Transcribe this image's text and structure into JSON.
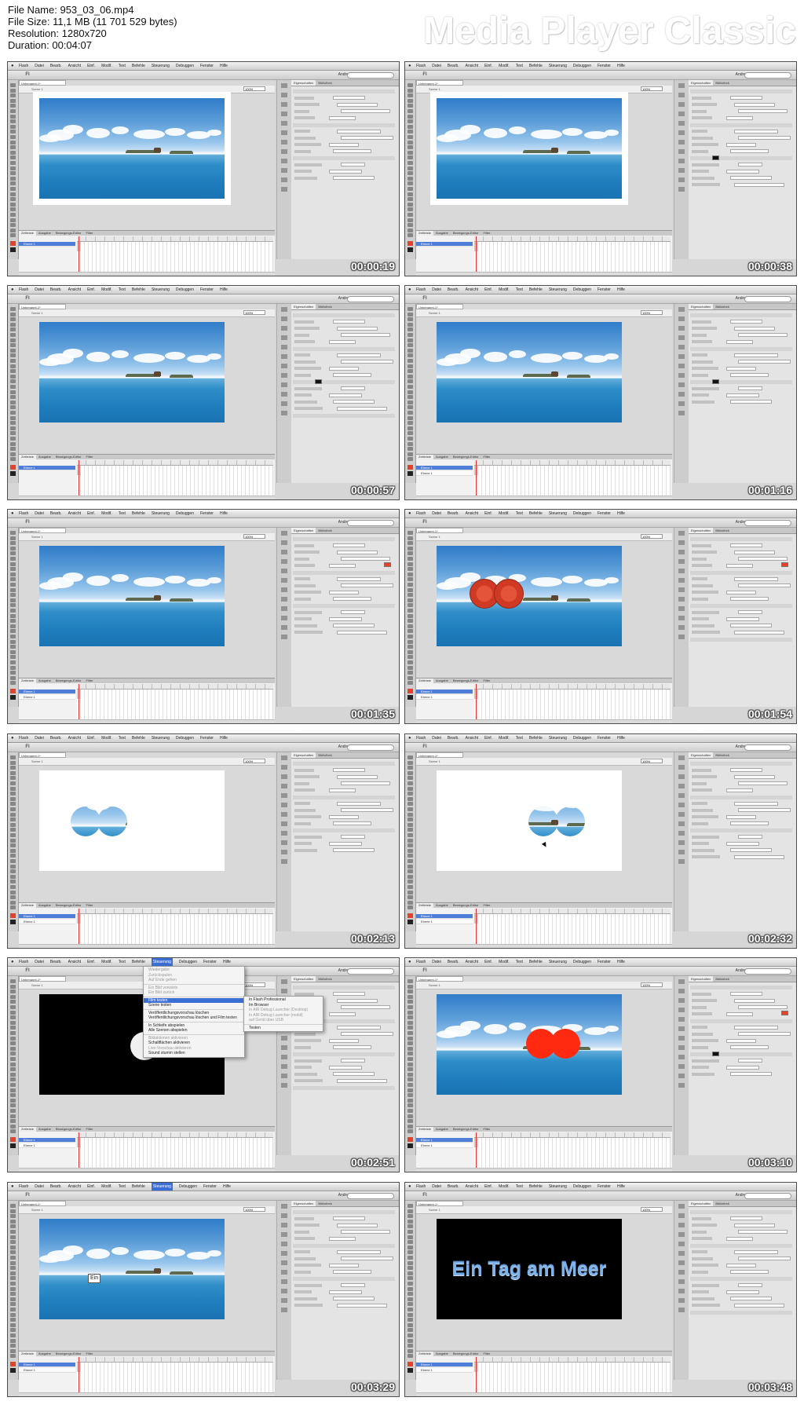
{
  "info": {
    "file_name": "File Name: 953_03_06.mp4",
    "file_size": "File Size: 11,1 MB (11 701 529 bytes)",
    "resolution": "Resolution: 1280x720",
    "duration": "Duration: 00:04:07"
  },
  "player_title": "Media Player Classic",
  "app": {
    "menu": [
      "Flash",
      "Datei",
      "Bearb.",
      "Ansicht",
      "Einf.",
      "Modif.",
      "Text",
      "Befehle",
      "Steuerung",
      "Debuggen",
      "Fenster",
      "Hilfe"
    ],
    "logo": "Fl",
    "workspace": "Andre",
    "doc_tab": "Unbenannt-1*",
    "scene_label": "Szene 1",
    "zoom": "100%",
    "props_tabs": [
      "Eigenschaften",
      "Bibliothek"
    ],
    "timeline_tabs": [
      "Zeitleiste",
      "Ausgabe",
      "Bewegungs-Editor",
      "Filter"
    ],
    "layer_name": "Ebene 1"
  },
  "thumbnails": [
    {
      "time": "00:00:19",
      "scene": "beach"
    },
    {
      "time": "00:00:38",
      "scene": "beach"
    },
    {
      "time": "00:00:57",
      "scene": "beach"
    },
    {
      "time": "00:01:16",
      "scene": "beach"
    },
    {
      "time": "00:01:35",
      "scene": "beach"
    },
    {
      "time": "00:01:54",
      "scene": "beach-red-textured"
    },
    {
      "time": "00:02:13",
      "scene": "mask-left"
    },
    {
      "time": "00:02:32",
      "scene": "mask-right"
    },
    {
      "time": "00:02:51",
      "scene": "black-menu"
    },
    {
      "time": "00:03:10",
      "scene": "beach-red-solid"
    },
    {
      "time": "00:03:29",
      "scene": "beach-textbox"
    },
    {
      "time": "00:03:48",
      "scene": "black-title"
    }
  ],
  "frame_10_textbox": "Ein",
  "frame_12_title": "Ein Tag am Meer",
  "control_menu": {
    "main_items": [
      {
        "label": "Wiedergabe",
        "dim": true
      },
      {
        "label": "Zurückspulen",
        "dim": true
      },
      {
        "label": "Auf Ende gehen",
        "dim": true
      },
      {
        "label": "sep"
      },
      {
        "label": "Ein Bild vorwärts",
        "dim": true
      },
      {
        "label": "Ein Bild zurück",
        "dim": true
      },
      {
        "label": "sep"
      },
      {
        "label": "Film testen",
        "hl": true
      },
      {
        "label": "Szene testen"
      },
      {
        "label": "sep"
      },
      {
        "label": "Veröffentlichungsvorschau löschen"
      },
      {
        "label": "Veröffentlichungsvorschau löschen und Film testen"
      },
      {
        "label": "sep"
      },
      {
        "label": "In Schleife abspielen"
      },
      {
        "label": "Alle Szenen abspielen"
      },
      {
        "label": "sep"
      },
      {
        "label": "Bildaktionen aktivieren",
        "dim": true
      },
      {
        "label": "Schaltflächen aktivieren"
      },
      {
        "label": "Live-Vorschau aktivieren",
        "dim": true
      },
      {
        "label": "Sound stumm stellen"
      }
    ],
    "sub_items": [
      {
        "label": "In Flash Professional",
        "hl": false
      },
      {
        "label": "Im Browser"
      },
      {
        "label": "In AIR Debug Launcher (Desktop)",
        "dim": true
      },
      {
        "label": "In AIR Debug Launcher (mobil)",
        "dim": true
      },
      {
        "label": "auf Gerät über USB",
        "dim": true
      },
      {
        "label": "sep"
      },
      {
        "label": "Testen"
      }
    ]
  },
  "colors": {
    "accent_red": "#e2432a",
    "menu_highlight": "#3b6fd6",
    "sea": "#1f7dbd",
    "sky": "#5d9ed9"
  }
}
